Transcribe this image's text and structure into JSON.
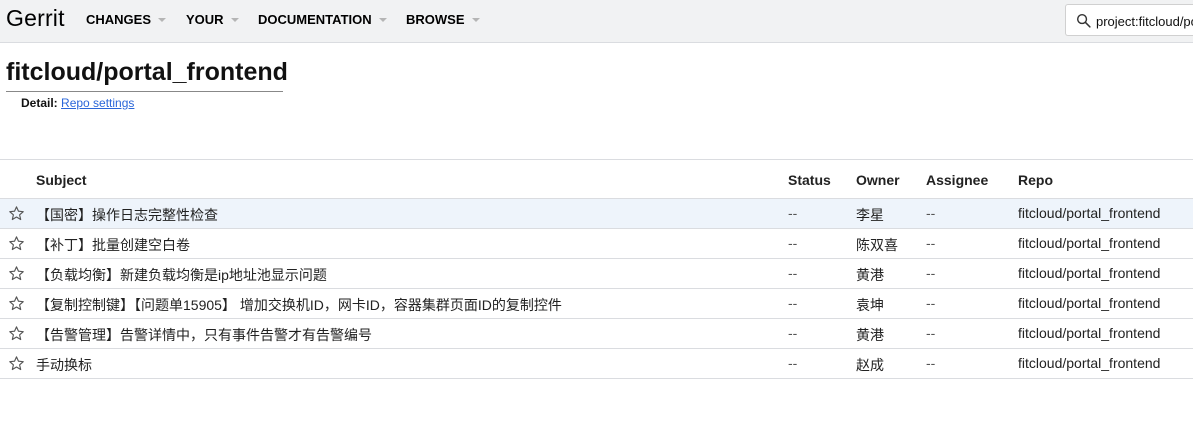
{
  "header": {
    "logo": "Gerrit",
    "menus": [
      {
        "label": "CHANGES"
      },
      {
        "label": "YOUR"
      },
      {
        "label": "DOCUMENTATION"
      },
      {
        "label": "BROWSE"
      }
    ],
    "search_value": "project:fitcloud/portal_frontend"
  },
  "project": {
    "title": "fitcloud/portal_frontend",
    "detail_label": "Detail:",
    "detail_link": "Repo settings"
  },
  "table": {
    "columns": {
      "subject": "Subject",
      "status": "Status",
      "owner": "Owner",
      "assignee": "Assignee",
      "repo": "Repo"
    },
    "rows": [
      {
        "subject": "【国密】操作日志完整性检查",
        "status": "--",
        "owner": "李星",
        "assignee": "--",
        "repo": "fitcloud/portal_frontend"
      },
      {
        "subject": "【补丁】批量创建空白卷",
        "status": "--",
        "owner": "陈双喜",
        "assignee": "--",
        "repo": "fitcloud/portal_frontend"
      },
      {
        "subject": "【负载均衡】新建负载均衡是ip地址池显示问题",
        "status": "--",
        "owner": "黄港",
        "assignee": "--",
        "repo": "fitcloud/portal_frontend"
      },
      {
        "subject": "【复制控制键】【问题单15905】 增加交换机ID，网卡ID，容器集群页面ID的复制控件",
        "status": "--",
        "owner": "袁坤",
        "assignee": "--",
        "repo": "fitcloud/portal_frontend"
      },
      {
        "subject": "【告警管理】告警详情中，只有事件告警才有告警编号",
        "status": "--",
        "owner": "黄港",
        "assignee": "--",
        "repo": "fitcloud/portal_frontend"
      },
      {
        "subject": "手动换标",
        "status": "--",
        "owner": "赵成",
        "assignee": "--",
        "repo": "fitcloud/portal_frontend"
      }
    ]
  },
  "colors": {
    "topbar_bg": "#f1f2f3",
    "link": "#2a66d9",
    "selected_row_bg": "#eef4fb"
  },
  "icons": {
    "search": "search-icon",
    "star": "star-outline-icon",
    "menu_caret": "caret-down-icon"
  }
}
